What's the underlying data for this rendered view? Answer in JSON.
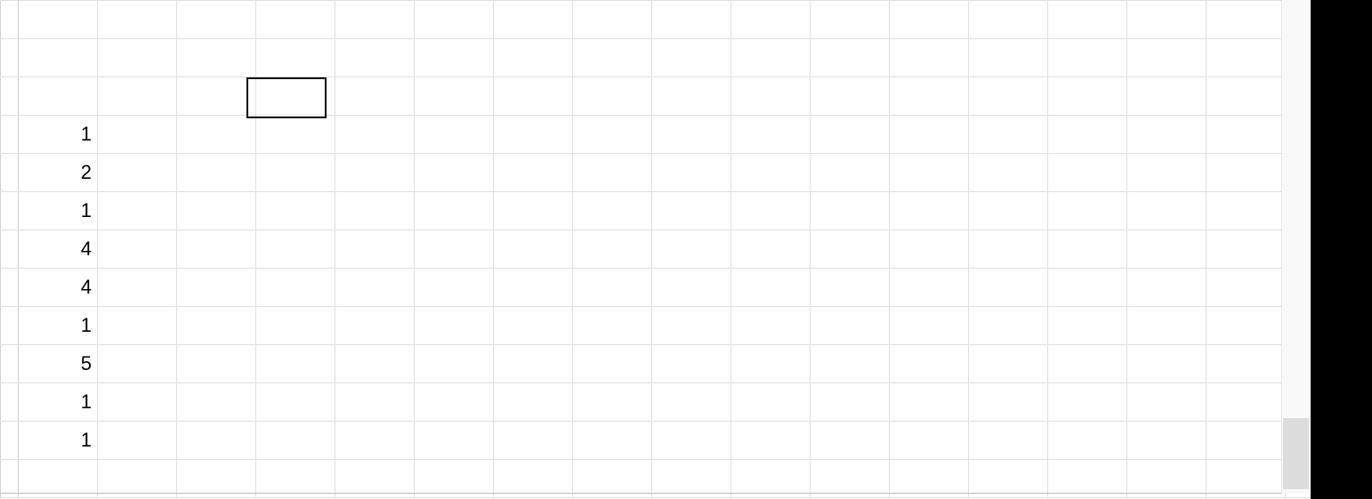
{
  "spreadsheet": {
    "visible_rows": 13,
    "visible_cols": 17,
    "row_header_present": true,
    "selected_cell": {
      "row": 2,
      "col": 3
    },
    "cells": {
      "r3c0": "1",
      "r4c0": "2",
      "r5c0": "1",
      "r6c0": "4",
      "r7c0": "4",
      "r8c0": "1",
      "r9c0": "5",
      "r10c0": "1",
      "r11c0": "1"
    }
  },
  "scrollbar": {
    "orientation": "vertical",
    "thumb_position": "near-bottom"
  }
}
